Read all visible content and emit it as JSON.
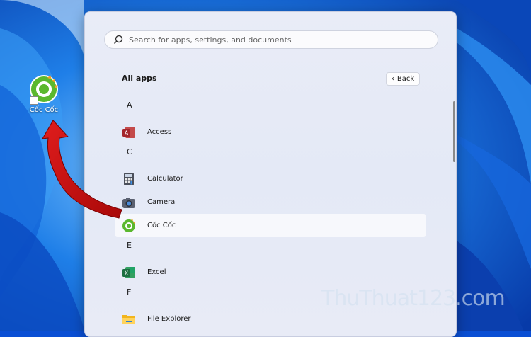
{
  "desktop": {
    "shortcut_label": "Cốc Cốc"
  },
  "start_menu": {
    "search_placeholder": "Search for apps, settings, and documents",
    "heading": "All apps",
    "back_label": "Back",
    "sections": [
      {
        "letter": "A",
        "apps": [
          {
            "name": "Access",
            "icon": "access-icon"
          }
        ]
      },
      {
        "letter": "C",
        "apps": [
          {
            "name": "Calculator",
            "icon": "calculator-icon"
          },
          {
            "name": "Camera",
            "icon": "camera-icon"
          },
          {
            "name": "Cốc Cốc",
            "icon": "coccoc-icon",
            "selected": true
          }
        ]
      },
      {
        "letter": "E",
        "apps": [
          {
            "name": "Excel",
            "icon": "excel-icon"
          }
        ]
      },
      {
        "letter": "F",
        "apps": [
          {
            "name": "File Explorer",
            "icon": "file-explorer-icon"
          }
        ]
      }
    ]
  },
  "watermark": "ThuThuat123.com",
  "colors": {
    "accent_arrow": "#c40d0d",
    "coccoc_green": "#5bb82e",
    "excel_green": "#1d6f42",
    "access_red": "#a4262c"
  }
}
